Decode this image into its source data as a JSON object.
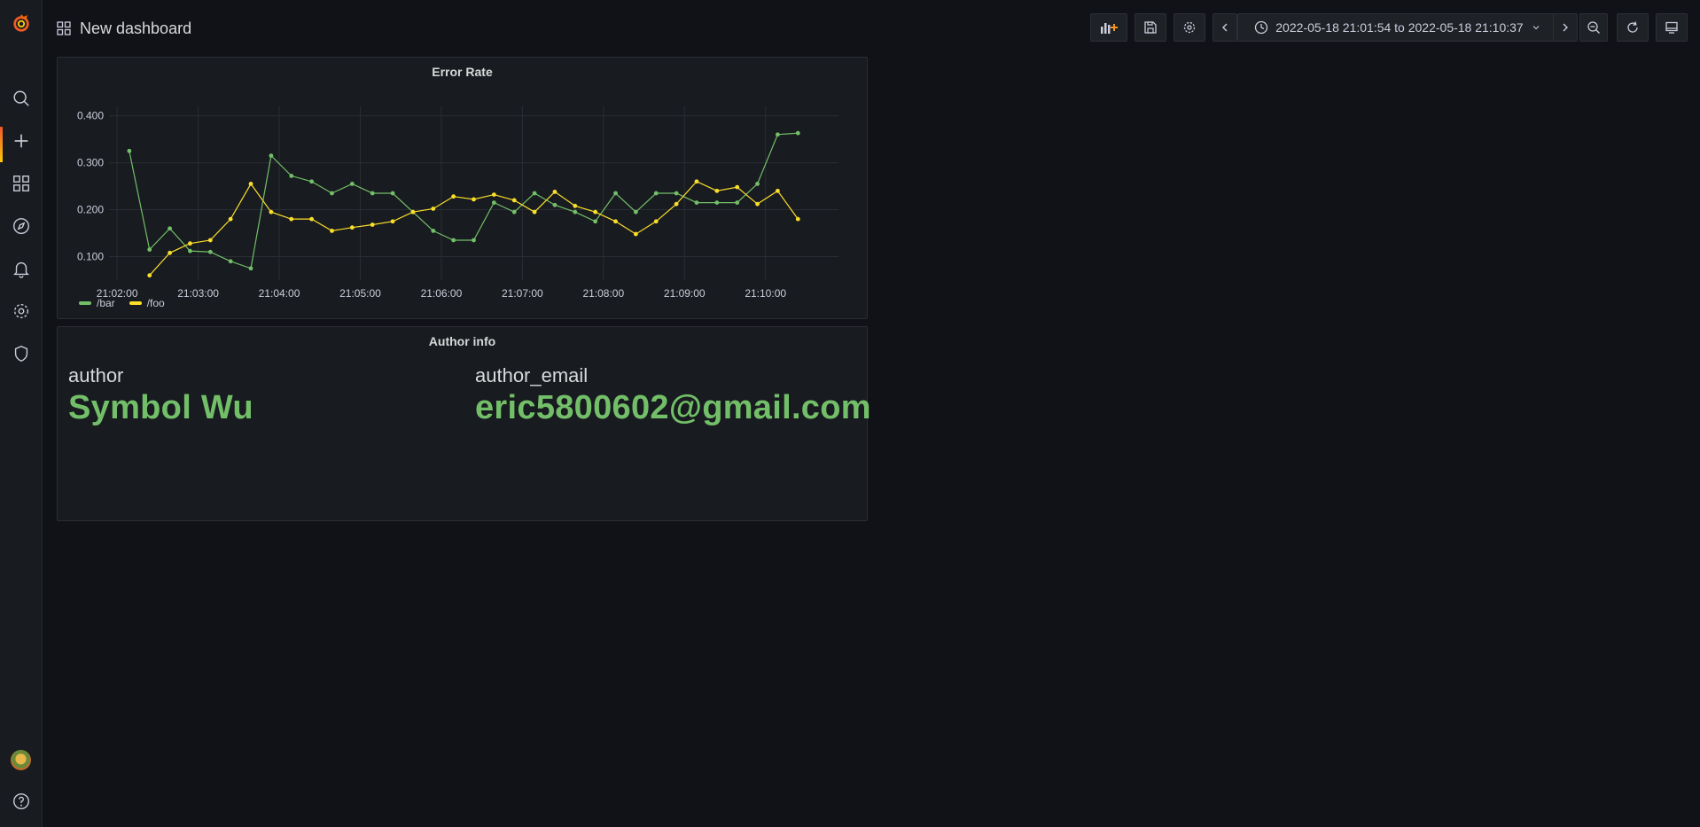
{
  "header": {
    "title": "New dashboard",
    "time_range": "2022-05-18 21:01:54 to 2022-05-18 21:10:37"
  },
  "sidebar": {
    "items": [
      {
        "icon": "search-icon"
      },
      {
        "icon": "plus-icon",
        "active": true
      },
      {
        "icon": "dashboards-icon"
      },
      {
        "icon": "compass-icon"
      },
      {
        "icon": "bell-icon"
      },
      {
        "icon": "gear-icon"
      },
      {
        "icon": "shield-icon"
      }
    ]
  },
  "panels": {
    "error_rate": {
      "title": "Error Rate"
    },
    "author_info": {
      "title": "Author info",
      "author_label": "author",
      "author_value": "Symbol Wu",
      "email_label": "author_email",
      "email_value": "eric5800602@gmail.com"
    }
  },
  "colors": {
    "bar": "#73bf69",
    "foo": "#fade2a",
    "accent": "#f05a28"
  },
  "chart_data": {
    "type": "line",
    "title": "Error Rate",
    "y_ticks": [
      "0.400",
      "0.300",
      "0.200",
      "0.100"
    ],
    "x_ticks": [
      "21:02:00",
      "21:03:00",
      "21:04:00",
      "21:05:00",
      "21:06:00",
      "21:07:00",
      "21:08:00",
      "21:09:00",
      "21:10:00"
    ],
    "ylim": [
      0.05,
      0.42
    ],
    "xlim_seconds": [
      0,
      540
    ],
    "legend": "bottom-left",
    "grid": true,
    "series": [
      {
        "name": "/bar",
        "color": "#73bf69",
        "x": [
          15,
          30,
          45,
          60,
          75,
          90,
          105,
          120,
          135,
          150,
          165,
          180,
          195,
          210,
          225,
          240,
          255,
          270,
          285,
          300,
          315,
          330,
          345,
          360,
          375,
          390,
          405,
          420,
          435,
          450,
          465,
          480,
          495,
          510
        ],
        "values": [
          0.325,
          0.115,
          0.16,
          0.112,
          0.11,
          0.09,
          0.075,
          0.315,
          0.272,
          0.26,
          0.235,
          0.255,
          0.235,
          0.235,
          0.195,
          0.155,
          0.135,
          0.135,
          0.215,
          0.195,
          0.235,
          0.21,
          0.195,
          0.175,
          0.235,
          0.195,
          0.235,
          0.235,
          0.215,
          0.215,
          0.215,
          0.255,
          0.36,
          0.363
        ]
      },
      {
        "name": "/foo",
        "color": "#fade2a",
        "x": [
          30,
          45,
          60,
          75,
          90,
          105,
          120,
          135,
          150,
          165,
          180,
          195,
          210,
          225,
          240,
          255,
          270,
          285,
          300,
          315,
          330,
          345,
          360,
          375,
          390,
          405,
          420,
          435,
          450,
          465,
          480,
          495,
          510
        ],
        "values": [
          0.06,
          0.108,
          0.128,
          0.135,
          0.18,
          0.255,
          0.195,
          0.18,
          0.18,
          0.155,
          0.162,
          0.168,
          0.175,
          0.195,
          0.202,
          0.228,
          0.222,
          0.232,
          0.22,
          0.195,
          0.238,
          0.208,
          0.195,
          0.175,
          0.148,
          0.175,
          0.212,
          0.26,
          0.24,
          0.248,
          0.212,
          0.24,
          0.18
        ]
      }
    ]
  }
}
